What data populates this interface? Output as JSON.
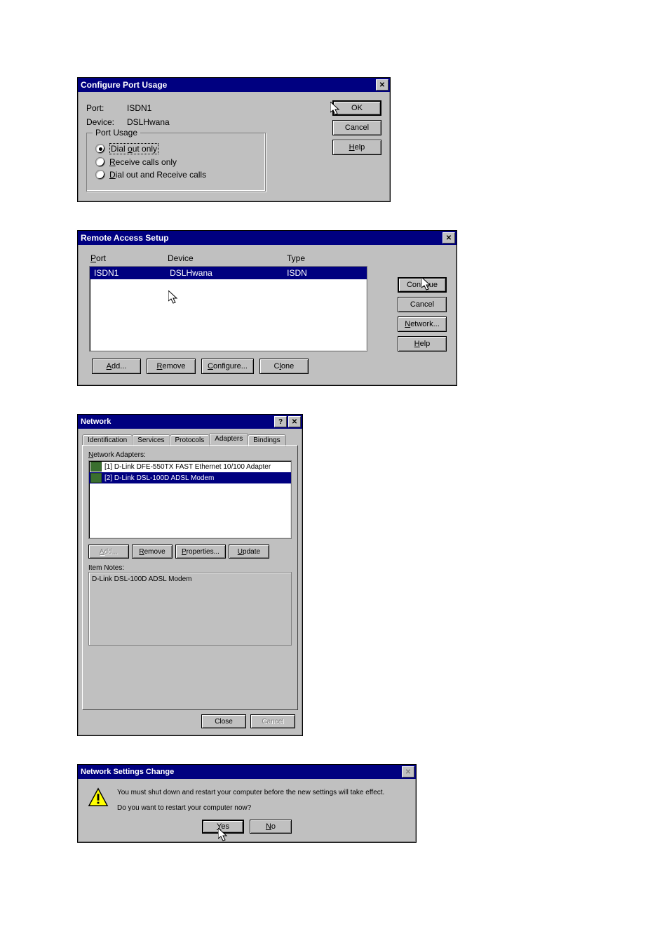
{
  "dialog1": {
    "title": "Configure Port Usage",
    "port_label": "Port:",
    "port_value": "ISDN1",
    "device_label": "Device:",
    "device_value": "DSLHwana",
    "fieldset_legend": "Port Usage",
    "radio1": "Dial out only",
    "radio2": "Receive calls only",
    "radio3": "Dial out and Receive calls",
    "buttons": {
      "ok": "OK",
      "cancel": "Cancel",
      "help": "Help"
    }
  },
  "dialog2": {
    "title": "Remote Access Setup",
    "col_port": "Port",
    "col_device": "Device",
    "col_type": "Type",
    "row": {
      "port": "ISDN1",
      "device": "DSLHwana",
      "type": "ISDN"
    },
    "buttons": {
      "continue": "Continue",
      "cancel": "Cancel",
      "network": "Network...",
      "help": "Help",
      "add": "Add...",
      "remove": "Remove",
      "configure": "Configure...",
      "clone": "Clone"
    }
  },
  "dialog3": {
    "title": "Network",
    "tabs": {
      "identification": "Identification",
      "services": "Services",
      "protocols": "Protocols",
      "adapters": "Adapters",
      "bindings": "Bindings"
    },
    "adapters_label": "Network Adapters:",
    "adapter1": "[1] D-Link DFE-550TX FAST Ethernet 10/100 Adapter",
    "adapter2": "[2] D-Link DSL-100D ADSL Modem",
    "buttons": {
      "add": "Add...",
      "remove": "Remove",
      "properties": "Properties...",
      "update": "Update"
    },
    "item_notes_label": "Item Notes:",
    "item_notes_text": "D-Link DSL-100D ADSL Modem",
    "footer": {
      "close": "Close",
      "cancel": "Cancel"
    }
  },
  "dialog4": {
    "title": "Network Settings Change",
    "line1": "You must shut down and restart your computer before the new settings will take effect.",
    "line2": "Do you want to restart your computer now?",
    "buttons": {
      "yes": "Yes",
      "no": "No"
    }
  }
}
